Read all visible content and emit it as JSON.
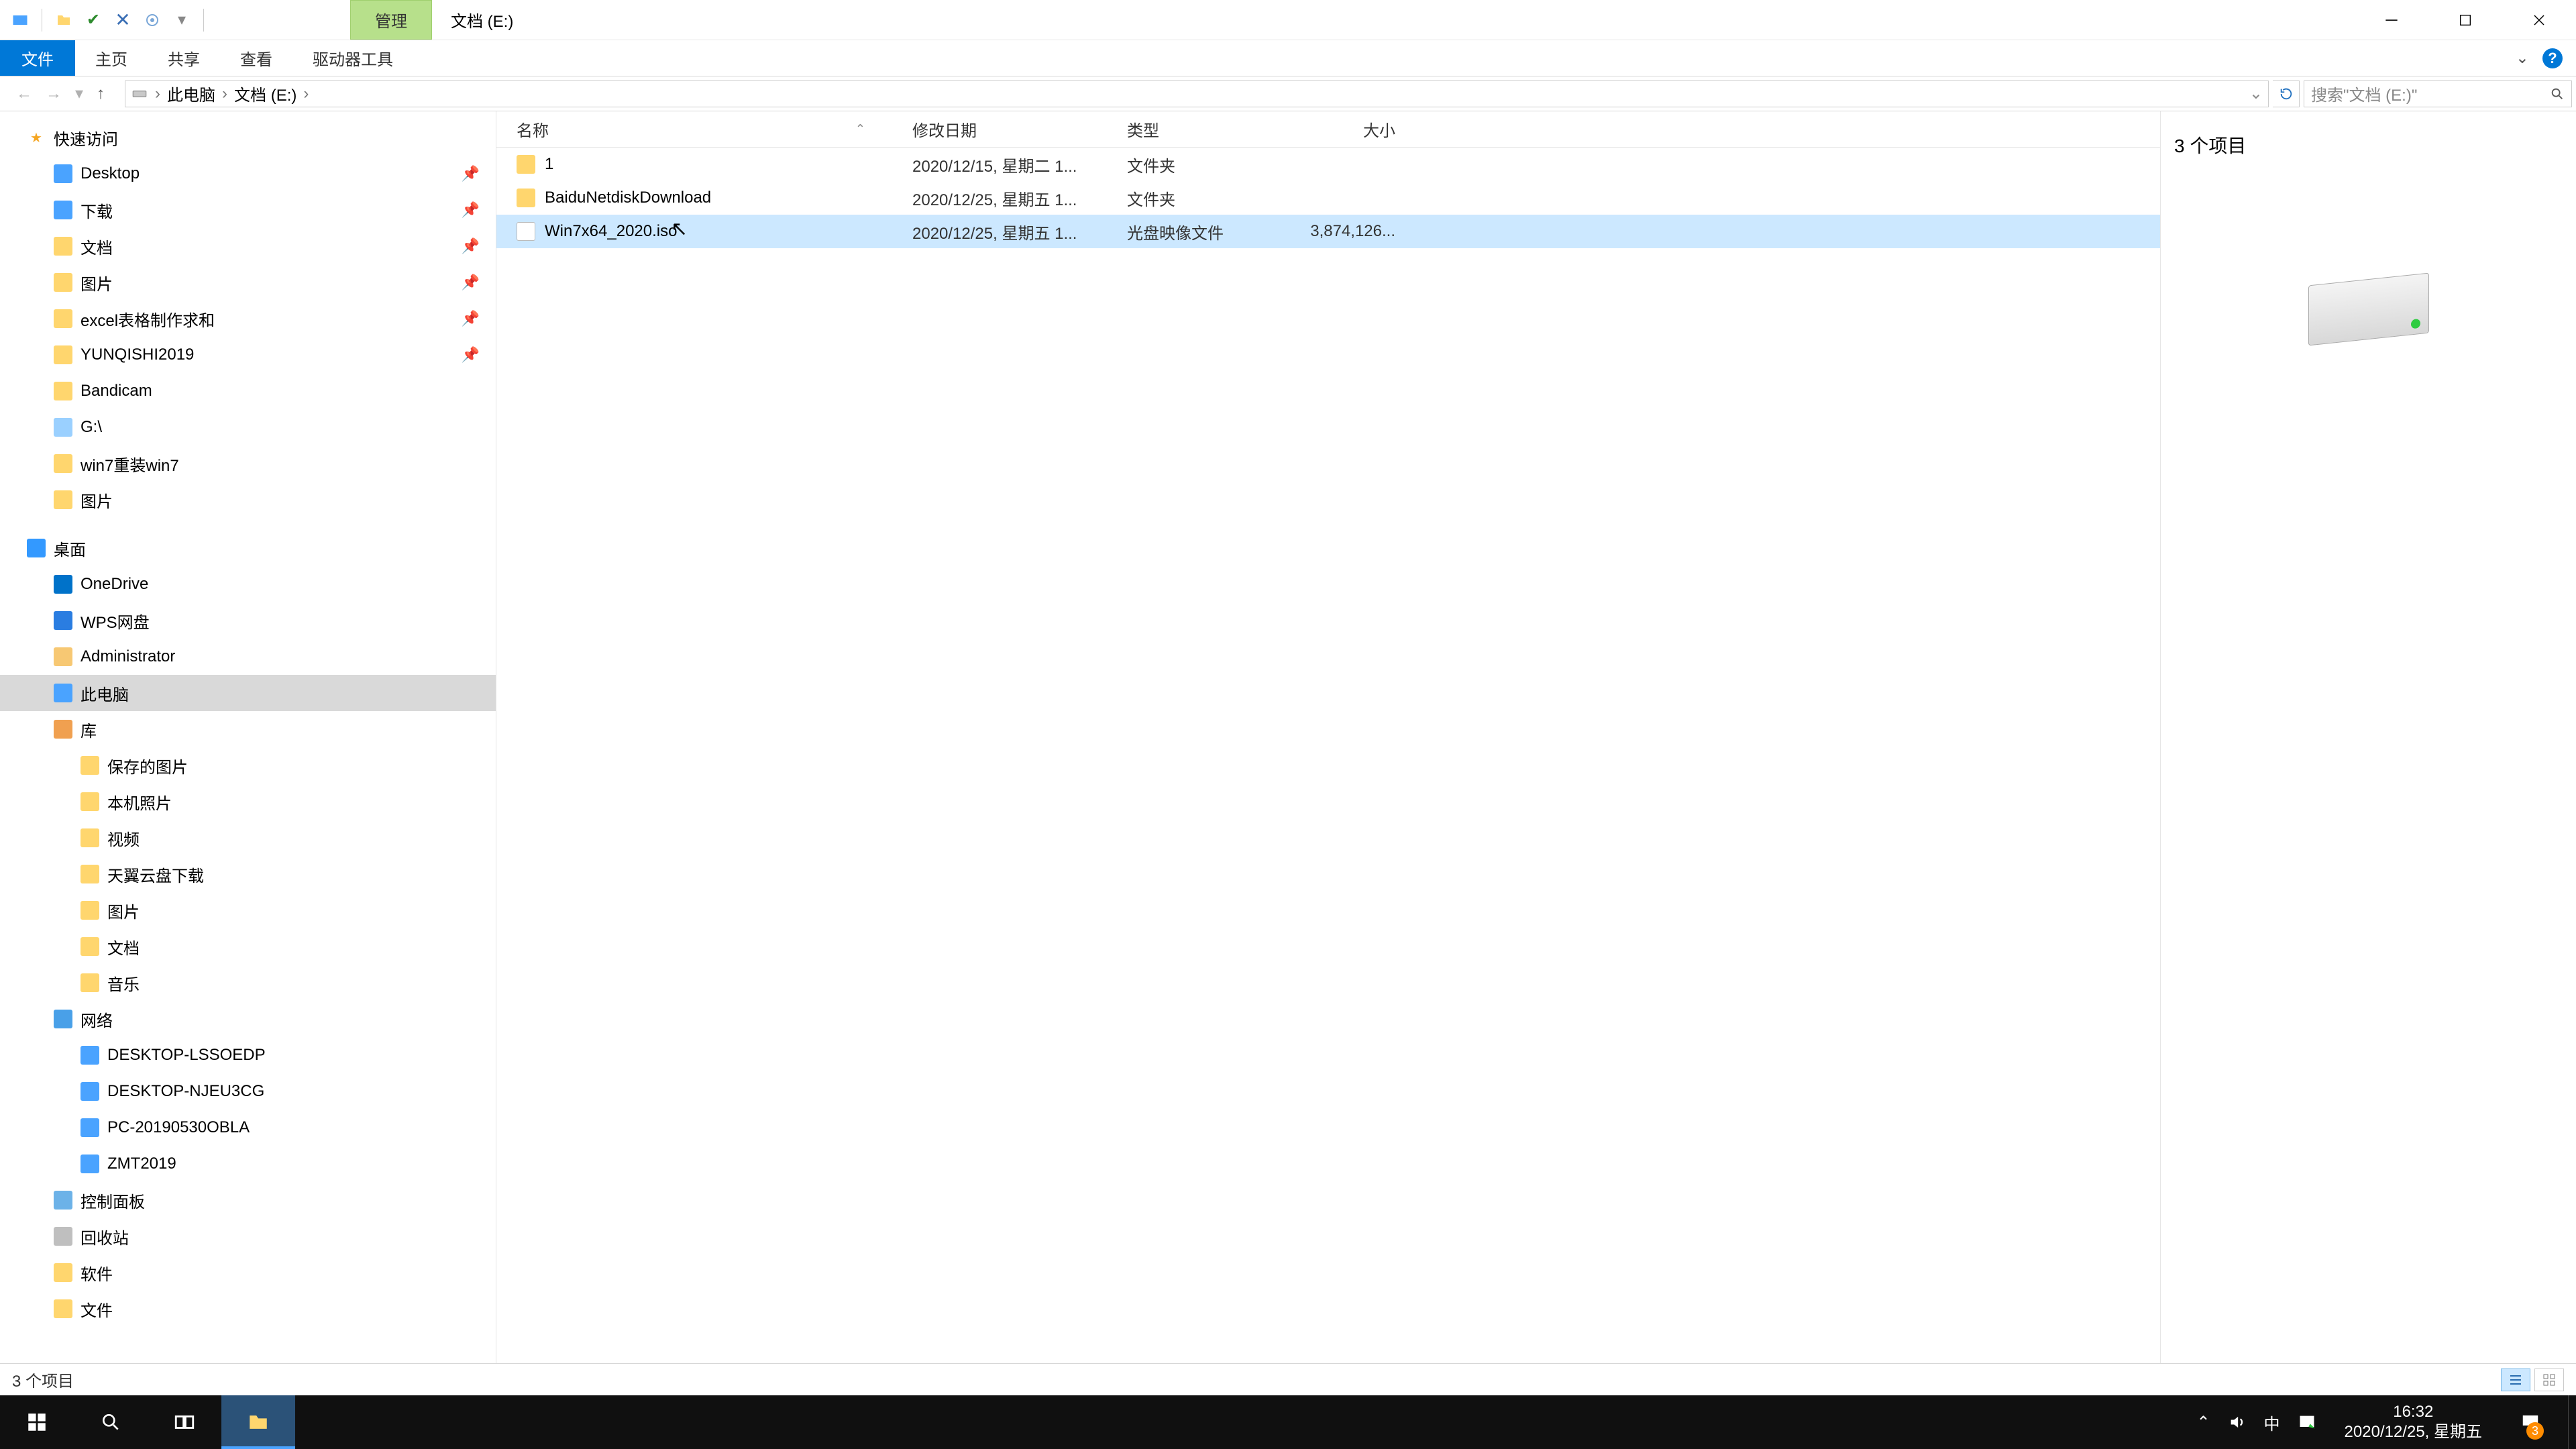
{
  "titlebar": {
    "context_tab": "管理",
    "title": "文档 (E:)"
  },
  "ribbon": {
    "file": "文件",
    "tabs": [
      "主页",
      "共享",
      "查看",
      "驱动器工具"
    ]
  },
  "nav": {
    "crumb1": "此电脑",
    "crumb2": "文档 (E:)",
    "search_placeholder": "搜索\"文档 (E:)\""
  },
  "columns": {
    "name": "名称",
    "date": "修改日期",
    "type": "类型",
    "size": "大小"
  },
  "rows": [
    {
      "name": "1",
      "date": "2020/12/15, 星期二 1...",
      "type": "文件夹",
      "size": "",
      "icon": "folder",
      "selected": false
    },
    {
      "name": "BaiduNetdiskDownload",
      "date": "2020/12/25, 星期五 1...",
      "type": "文件夹",
      "size": "",
      "icon": "folder",
      "selected": false
    },
    {
      "name": "Win7x64_2020.iso",
      "date": "2020/12/25, 星期五 1...",
      "type": "光盘映像文件",
      "size": "3,874,126...",
      "icon": "file",
      "selected": true
    }
  ],
  "sidebar": {
    "quick": {
      "label": "快速访问"
    },
    "quick_items": [
      {
        "label": "Desktop",
        "icon": "blue",
        "pin": true
      },
      {
        "label": "下载",
        "icon": "blue",
        "pin": true
      },
      {
        "label": "文档",
        "icon": "folder",
        "pin": true
      },
      {
        "label": "图片",
        "icon": "folder",
        "pin": true
      },
      {
        "label": "excel表格制作求和",
        "icon": "folder",
        "pin": true
      },
      {
        "label": "YUNQISHI2019",
        "icon": "folder",
        "pin": true
      },
      {
        "label": "Bandicam",
        "icon": "folder",
        "pin": false
      },
      {
        "label": "G:\\",
        "icon": "disk",
        "pin": false
      },
      {
        "label": "win7重装win7",
        "icon": "folder",
        "pin": false
      },
      {
        "label": "图片",
        "icon": "folder",
        "pin": false
      }
    ],
    "desktop": {
      "label": "桌面"
    },
    "desktop_items": [
      {
        "label": "OneDrive",
        "icon": "cloud"
      },
      {
        "label": "WPS网盘",
        "icon": "wps"
      },
      {
        "label": "Administrator",
        "icon": "user"
      },
      {
        "label": "此电脑",
        "icon": "pc",
        "selected": true
      },
      {
        "label": "库",
        "icon": "lib"
      }
    ],
    "lib_items": [
      {
        "label": "保存的图片"
      },
      {
        "label": "本机照片"
      },
      {
        "label": "视频"
      },
      {
        "label": "天翼云盘下载"
      },
      {
        "label": "图片"
      },
      {
        "label": "文档"
      },
      {
        "label": "音乐"
      }
    ],
    "network": {
      "label": "网络"
    },
    "network_items": [
      {
        "label": "DESKTOP-LSSOEDP"
      },
      {
        "label": "DESKTOP-NJEU3CG"
      },
      {
        "label": "PC-20190530OBLA"
      },
      {
        "label": "ZMT2019"
      }
    ],
    "tail": [
      {
        "label": "控制面板",
        "icon": "ctrl"
      },
      {
        "label": "回收站",
        "icon": "recyc"
      },
      {
        "label": "软件",
        "icon": "folder"
      },
      {
        "label": "文件",
        "icon": "folder"
      }
    ]
  },
  "preview": {
    "count": "3 个项目"
  },
  "statusbar": {
    "text": "3 个项目"
  },
  "tray": {
    "ime": "中",
    "time": "16:32",
    "date": "2020/12/25, 星期五",
    "notif_count": "3"
  }
}
